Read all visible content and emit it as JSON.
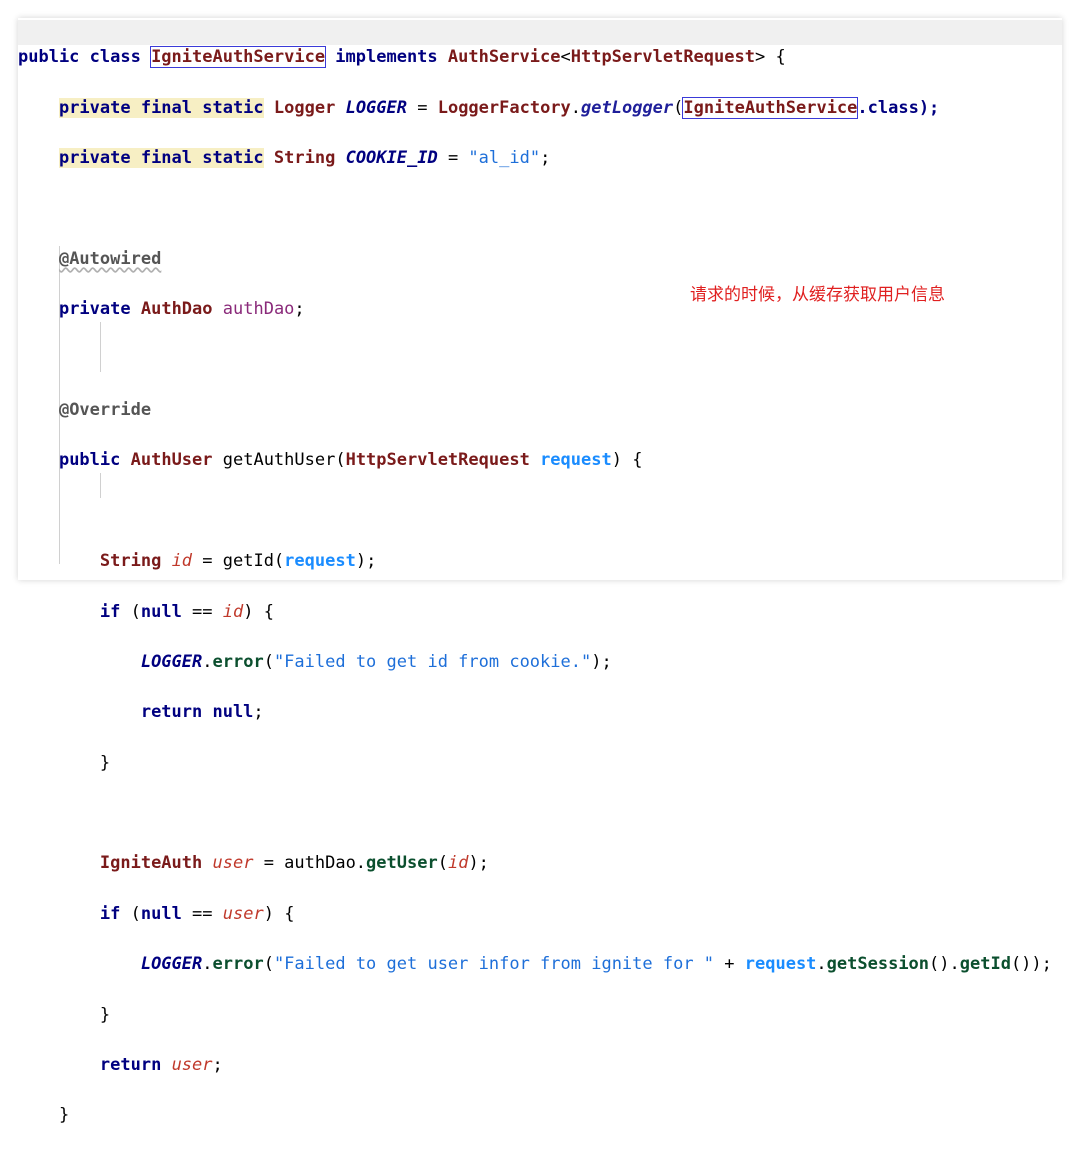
{
  "code": {
    "l1": {
      "a": "public class ",
      "b": "IgniteAuthService",
      "c": " implements ",
      "d": "AuthService",
      "e": "<",
      "f": "HttpServletRequest",
      "g": "> {"
    },
    "l2": {
      "ind": "    ",
      "kw": "private final static",
      "sp": " ",
      "type": "Logger",
      "sp2": " ",
      "field": "LOGGER",
      "eq": " = ",
      "cls": "LoggerFactory",
      "dot": ".",
      "meth": "getLogger",
      "p1": "(",
      "box": "IgniteAuthService",
      "end": ".class);"
    },
    "l3": {
      "ind": "    ",
      "kw": "private final static",
      "sp": " ",
      "type": "String",
      "sp2": " ",
      "field": "COOKIE_ID",
      "eq": " = ",
      "str": "\"al_id\"",
      "end": ";"
    },
    "l5": {
      "ind": "    ",
      "ann": "@Autowired"
    },
    "l6": {
      "ind": "    ",
      "kw": "private",
      "sp": " ",
      "type": "AuthDao",
      "sp2": " ",
      "name": "authDao",
      "end": ";"
    },
    "l8": {
      "ind": "    ",
      "ann": "@Override"
    },
    "l9": {
      "ind": "    ",
      "kw": "public",
      "sp": " ",
      "type": "AuthUser",
      "sp2": " getAuthUser(",
      "ptype": "HttpServletRequest",
      "sp3": " ",
      "param": "request",
      "end": ") {"
    },
    "l11": {
      "ind": "        ",
      "type": "String",
      "sp": " ",
      "local": "id",
      "eq": " = getId(",
      "param": "request",
      "end": ");"
    },
    "l12": {
      "ind": "        ",
      "kw": "if",
      "sp": " (",
      "kw2": "null",
      "eq": " == ",
      "local": "id",
      "end": ") {"
    },
    "l13": {
      "ind": "            ",
      "field": "LOGGER",
      "dot": ".",
      "meth": "error",
      "p1": "(",
      "str": "\"Failed to get id from cookie.\"",
      "end": ");"
    },
    "l14": {
      "ind": "            ",
      "kw": "return null",
      "end": ";"
    },
    "l15": {
      "ind": "        ",
      "end": "}"
    },
    "l17": {
      "ind": "        ",
      "type": "IgniteAuth",
      "sp": " ",
      "local": "user",
      "eq": " = authDao.",
      "meth": "getUser",
      "p1": "(",
      "local2": "id",
      "end": ");"
    },
    "l18": {
      "ind": "        ",
      "kw": "if",
      "sp": " (",
      "kw2": "null",
      "eq": " == ",
      "local": "user",
      "end": ") {"
    },
    "l19": {
      "ind": "            ",
      "field": "LOGGER",
      "dot": ".",
      "meth": "error",
      "p1": "(",
      "str": "\"Failed to get user infor from ignite for \"",
      "plus": " + ",
      "param": "request",
      "dot2": ".",
      "meth2": "getSession",
      "mid": "().",
      "meth3": "getId",
      "end": "());"
    },
    "l20": {
      "ind": "        ",
      "end": "}"
    },
    "l21": {
      "ind": "        ",
      "kw": "return",
      "sp": " ",
      "local": "user",
      "end": ";"
    },
    "l22": {
      "ind": "    ",
      "end": "}"
    }
  },
  "annotation": {
    "text": "请求的时候，从缓存获取用户信息"
  },
  "colors": {
    "annotation": "#e02020",
    "keyword": "#000080",
    "type": "#7a1a1a",
    "string": "#1e6fd9",
    "local": "#c0392b",
    "param": "#1a8cff"
  }
}
